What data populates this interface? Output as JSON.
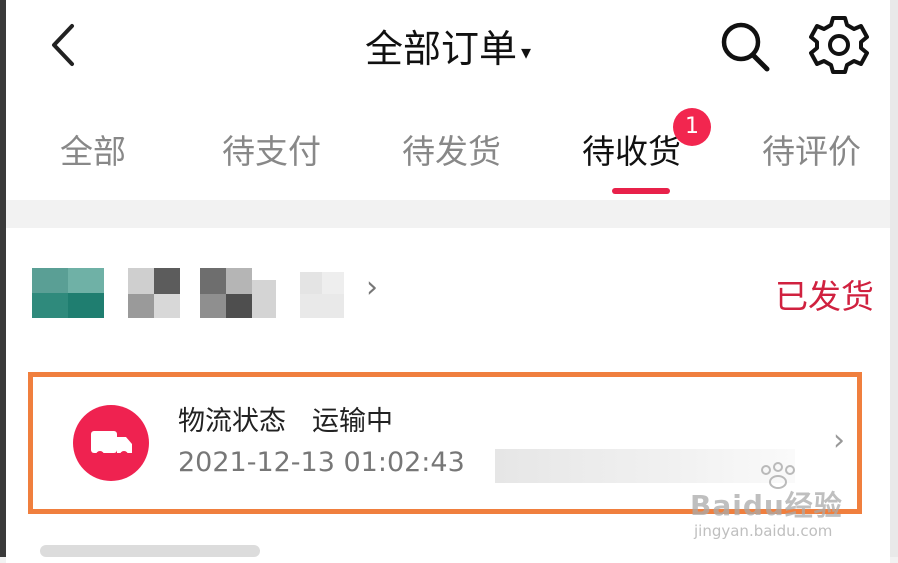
{
  "header": {
    "title": "全部订单",
    "caret": "▾"
  },
  "tabs": [
    {
      "label": "全部",
      "active": false
    },
    {
      "label": "待支付",
      "active": false
    },
    {
      "label": "待发货",
      "active": false
    },
    {
      "label": "待收货",
      "active": true,
      "badge": "1"
    },
    {
      "label": "待评价",
      "active": false
    }
  ],
  "order": {
    "shop_chevron": "›",
    "status": "已发货",
    "logistics": {
      "label": "物流状态",
      "state": "运输中",
      "timestamp": "2021-12-13 01:02:43",
      "chevron": "›"
    }
  },
  "watermark": {
    "brand": "Baidu经验",
    "url": "jingyan.baidu.com"
  },
  "colors": {
    "accent": "#e8214a",
    "highlight_border": "#f07f3e",
    "status_text": "#d0213f"
  },
  "icons": [
    "back-icon",
    "search-icon",
    "gear-icon",
    "truck-icon",
    "chevron-right-icon"
  ]
}
